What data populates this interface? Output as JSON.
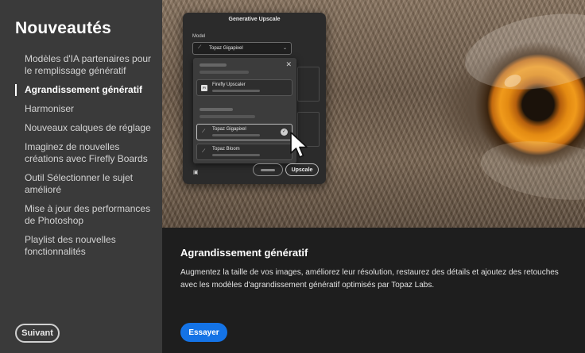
{
  "sidebar": {
    "title": "Nouveautés",
    "items": [
      {
        "label": "Modèles d'IA partenaires pour le remplissage génératif",
        "active": false
      },
      {
        "label": "Agrandissement génératif",
        "active": true
      },
      {
        "label": "Harmoniser",
        "active": false
      },
      {
        "label": "Nouveaux calques de réglage",
        "active": false
      },
      {
        "label": "Imaginez de nouvelles créations avec Firefly Boards",
        "active": false
      },
      {
        "label": "Outil Sélectionner le sujet amélioré",
        "active": false
      },
      {
        "label": "Mise à jour des performances de Photoshop",
        "active": false
      },
      {
        "label": "Playlist des nouvelles fonctionnalités",
        "active": false
      }
    ],
    "next_label": "Suivant"
  },
  "hero": {
    "dialog": {
      "title": "Generative Upscale",
      "model_label": "Model",
      "selected_model": "Topaz Gigapixel",
      "options": [
        {
          "name": "Firefly Upscaler",
          "icon": "firefly-icon"
        },
        {
          "name": "Topaz Gigapixel",
          "icon": "wand-icon",
          "selected": true
        },
        {
          "name": "Topaz Bloom",
          "icon": "wand-icon"
        }
      ],
      "upscale_label": "Upscale"
    }
  },
  "content": {
    "title": "Agrandissement génératif",
    "description": "Augmentez la taille de vos images, améliorez leur résolution, restaurez des détails et ajoutez des retouches avec les modèles d'agrandissement génératif optimisés par Topaz Labs.",
    "try_label": "Essayer"
  },
  "colors": {
    "sidebar_bg": "#3a3a3a",
    "content_bg": "#1e1e1e",
    "accent": "#1473e6"
  }
}
